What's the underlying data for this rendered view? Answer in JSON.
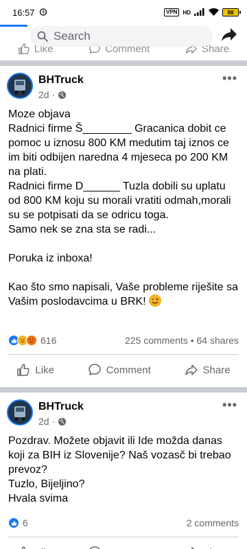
{
  "status_bar": {
    "time": "16:57",
    "vpn": "VPN",
    "hd": "HD",
    "battery": "98",
    "battery_level": 0.98
  },
  "search": {
    "placeholder": "Search"
  },
  "action_labels": {
    "like": "Like",
    "comment": "Comment",
    "share": "Share"
  },
  "posts": [
    {
      "author": "BHTruck",
      "time": "2d",
      "text": "Moze objava\nRadnici firme Š________ Gracanica dobit ce pomoc u iznosu 800 KM medutim taj iznos ce im biti odbijen naredna 4 mjeseca po 200 KM na plati.\nRadnici firme D______ Tuzla dobili su uplatu od 800 KM koju su morali vratiti odmah,morali su se potpisati da se odricu toga.\nSamo nek se zna sta se radi...\n\nPoruka iz inboxa!\n\nKao što smo napisali, Vaše probleme riješite sa Vašim poslodavcima u BRK!",
      "reaction_count": "616",
      "comments": "225 comments",
      "shares": "64 shares",
      "separator": "•"
    },
    {
      "author": "BHTruck",
      "time": "2d",
      "text": "Pozdrav. Možete objavit ili Ide možda danas koji za BIH iz Slovenije? Naš vozasč bi trebao prevoz?\nTuzlo, Bijeljino?\nHvala svima",
      "reaction_count": "6",
      "comments": "2 comments"
    }
  ],
  "colors": {
    "accent": "#1877f2",
    "muted": "#65676b",
    "feed_bg": "#c9ccd1"
  }
}
